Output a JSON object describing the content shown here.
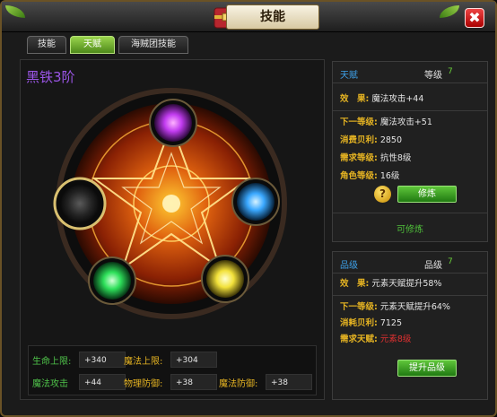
{
  "window": {
    "title": "技能",
    "close_glyph": "✖"
  },
  "tabs": [
    {
      "label": "技能",
      "active": false
    },
    {
      "label": "天赋",
      "active": true
    },
    {
      "label": "海贼团技能",
      "active": false
    }
  ],
  "left": {
    "tier": "黑铁3阶",
    "orbs": [
      {
        "name": "purple-orb",
        "color": "#c23cf0"
      },
      {
        "name": "blue-orb",
        "color": "#3aa8ff"
      },
      {
        "name": "yellow-orb",
        "color": "#f2e13a"
      },
      {
        "name": "green-orb",
        "color": "#2ee05a"
      },
      {
        "name": "dark-orb",
        "color": "#555555"
      }
    ],
    "stats": [
      {
        "label": "生命上限:",
        "value": "+340"
      },
      {
        "label": "魔法上限:",
        "value": "+304"
      },
      {
        "label": "魔法攻击",
        "value": "+44"
      },
      {
        "label": "物理防御:",
        "value": "+38"
      },
      {
        "label": "魔法防御:",
        "value": "+38"
      }
    ]
  },
  "talent": {
    "title": "天赋",
    "grade_label": "等级",
    "grade_value": "7",
    "effect_label": "效　果:",
    "effect_value": "魔法攻击+44",
    "next_label": "下一等级:",
    "next_value": "魔法攻击+51",
    "cost_label": "消费贝利:",
    "cost_value": "2850",
    "req_label": "需求等级:",
    "req_value": "抗性8级",
    "role_label": "角色等级:",
    "role_value": "16级",
    "help_glyph": "?",
    "button": "修炼",
    "status": "可修炼"
  },
  "quality": {
    "title": "品级",
    "grade_label": "品级",
    "grade_value": "7",
    "effect_label": "效　果:",
    "effect_value": "元素天赋提升58%",
    "next_label": "下一等级:",
    "next_value": "元素天赋提升64%",
    "cost_label": "消耗贝利:",
    "cost_value": "7125",
    "req_label": "需求天赋:",
    "req_value": "元素8级",
    "button": "提升品级"
  },
  "colors": {
    "accent_green": "#4fbf3a",
    "label_gold": "#e6b422",
    "header_blue": "#3ea0e8",
    "warn_red": "#e03030",
    "tier_purple": "#9b55e6"
  }
}
